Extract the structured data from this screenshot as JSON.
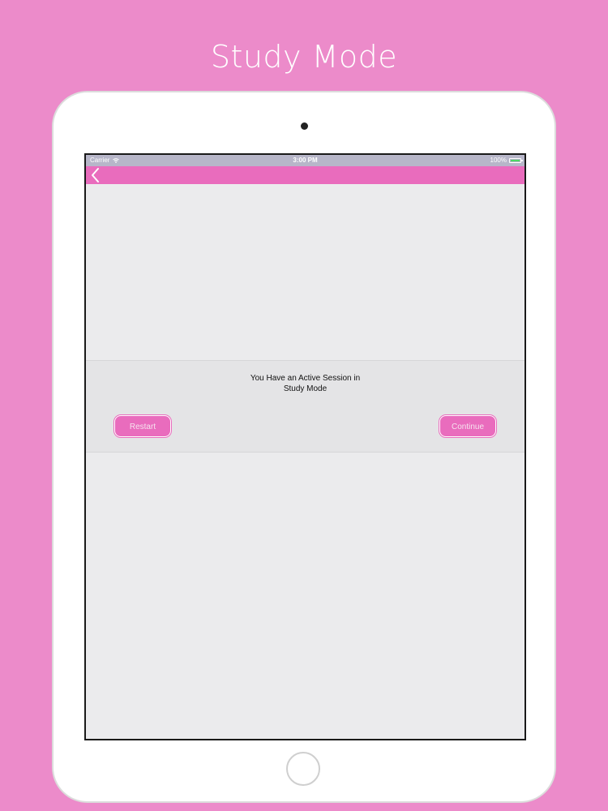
{
  "promo": {
    "title": "Study Mode"
  },
  "status_bar": {
    "carrier": "Carrier",
    "time": "3:00 PM",
    "battery": "100%"
  },
  "nav": {
    "back_icon": "chevron-left-icon"
  },
  "session_dialog": {
    "message_line1": "You Have an Active Session in",
    "message_line2": "Study Mode",
    "restart_label": "Restart",
    "continue_label": "Continue"
  },
  "colors": {
    "background": "#ec8bca",
    "accent": "#e96cbd",
    "screen_bg": "#ebebed",
    "status_bar": "#b7b6c9",
    "battery": "#4cd964"
  }
}
